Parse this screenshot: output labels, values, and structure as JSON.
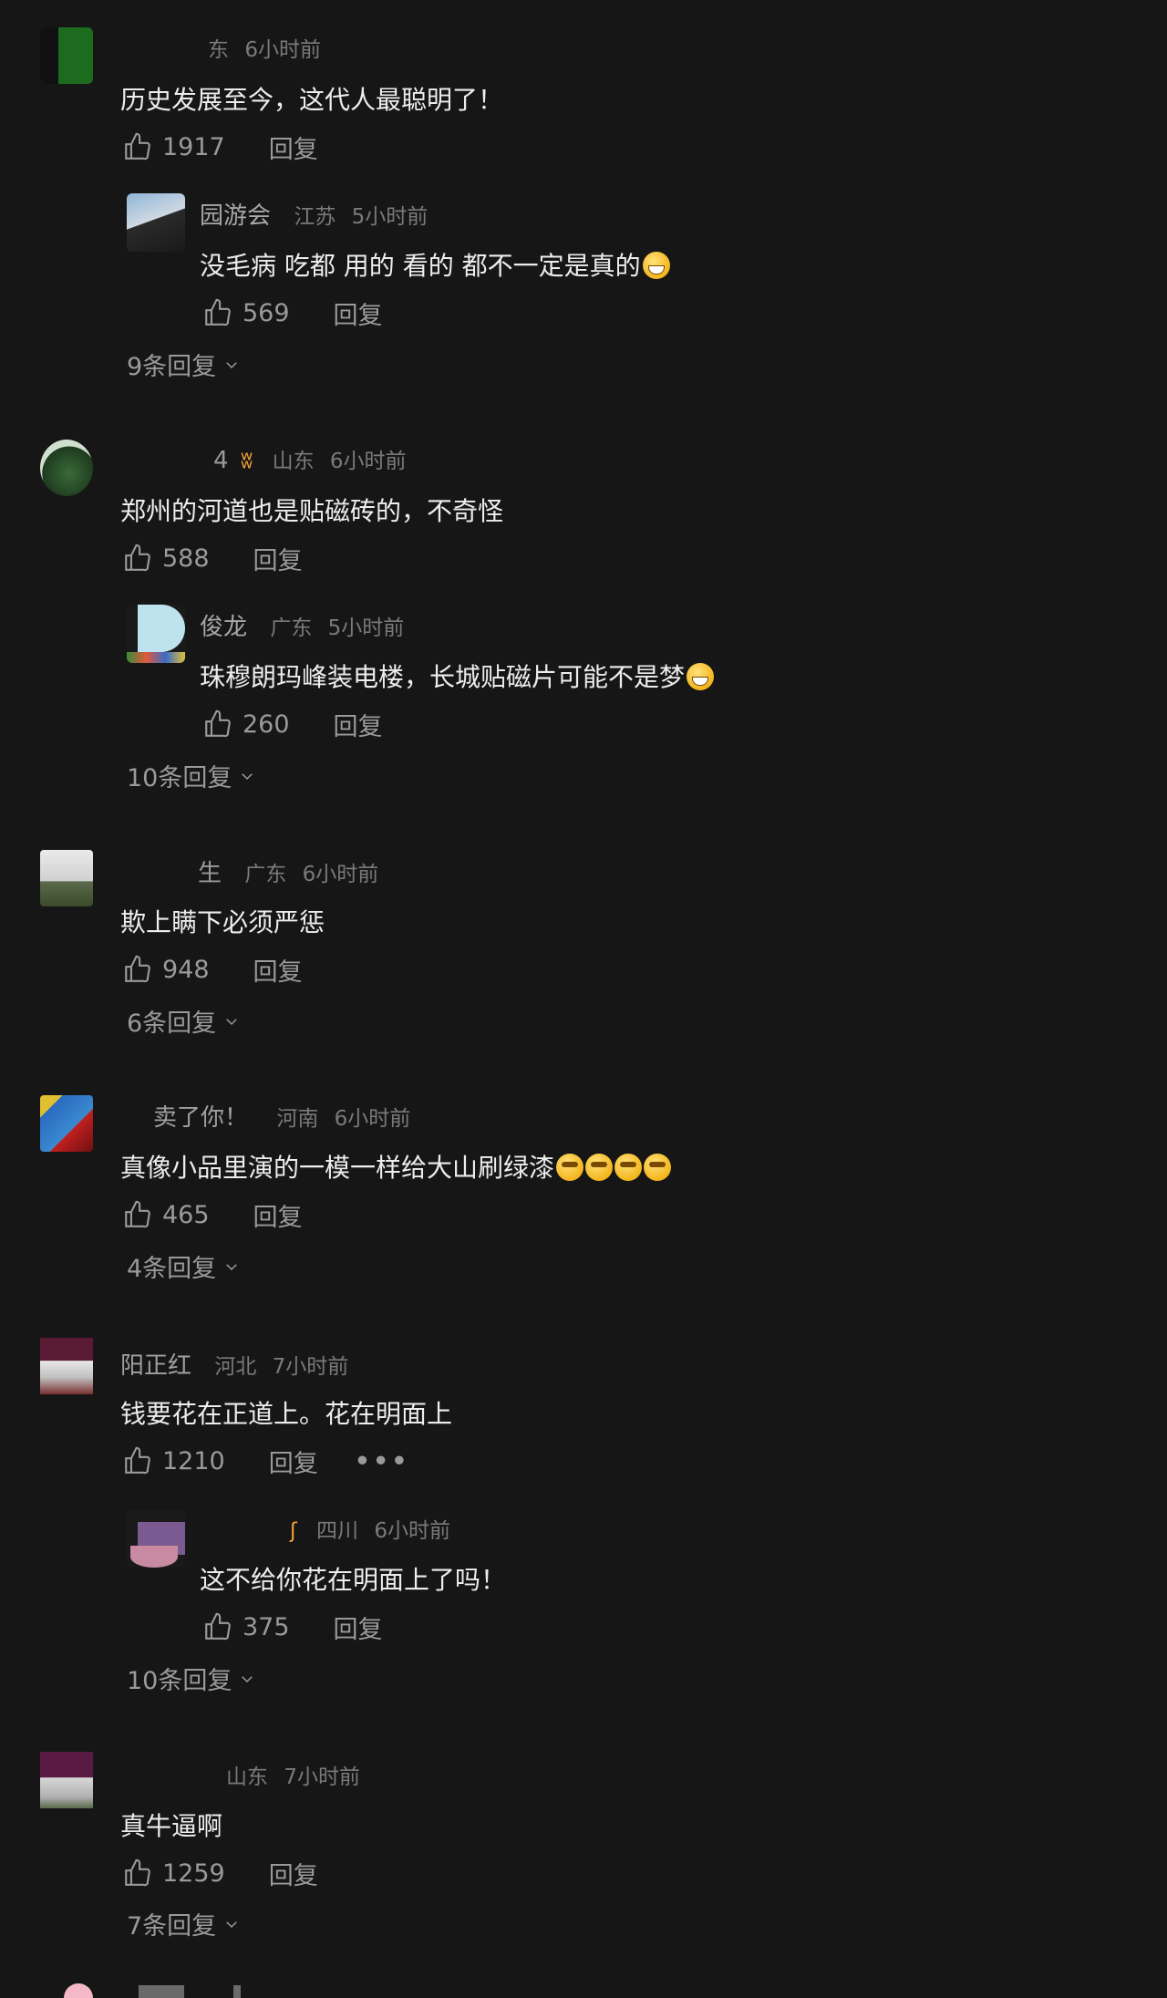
{
  "comments": [
    {
      "nick": "",
      "nick_tail": "东",
      "region": "",
      "time": "6小时前",
      "text": "历史发展至今，这代人最聪明了！",
      "likes": "1917",
      "reply_label": "回复",
      "sub": {
        "nick": "园游会",
        "region": "江苏",
        "time": "5小时前",
        "text": "没毛病 吃都 用的 看的 都不一定是真的",
        "likes": "569",
        "reply_label": "回复"
      },
      "expand": "9条回复"
    },
    {
      "nick": "4",
      "region": "山东",
      "time": "6小时前",
      "text": "郑州的河道也是贴磁砖的，不奇怪",
      "likes": "588",
      "reply_label": "回复",
      "sub": {
        "nick": "俊龙",
        "region": "广东",
        "time": "5小时前",
        "text": "珠穆朗玛峰装电楼，长城贴磁片可能不是梦",
        "likes": "260",
        "reply_label": "回复"
      },
      "expand": "10条回复"
    },
    {
      "nick": "生",
      "region": "广东",
      "time": "6小时前",
      "text": "欺上瞒下必须严惩",
      "likes": "948",
      "reply_label": "回复",
      "expand": "6条回复"
    },
    {
      "nick": "卖了你！",
      "region": "河南",
      "time": "6小时前",
      "text": "真像小品里演的一模一样给大山刷绿漆",
      "likes": "465",
      "reply_label": "回复",
      "expand": "4条回复"
    },
    {
      "nick": "阳正红",
      "region": "河北",
      "time": "7小时前",
      "text": "钱要花在正道上。花在明面上",
      "likes": "1210",
      "reply_label": "回复",
      "more": "•••",
      "sub": {
        "nick": "",
        "region": "四川",
        "time": "6小时前",
        "text": "这不给你花在明面上了吗！",
        "likes": "375",
        "reply_label": "回复"
      },
      "expand": "10条回复"
    },
    {
      "nick": "",
      "region": "山东",
      "time": "7小时前",
      "text": "真牛逼啊",
      "likes": "1259",
      "reply_label": "回复",
      "expand": "7条回复"
    }
  ],
  "colors": {
    "background": "#161616",
    "text": "#ededed",
    "secondary": "#7a7a7a"
  }
}
